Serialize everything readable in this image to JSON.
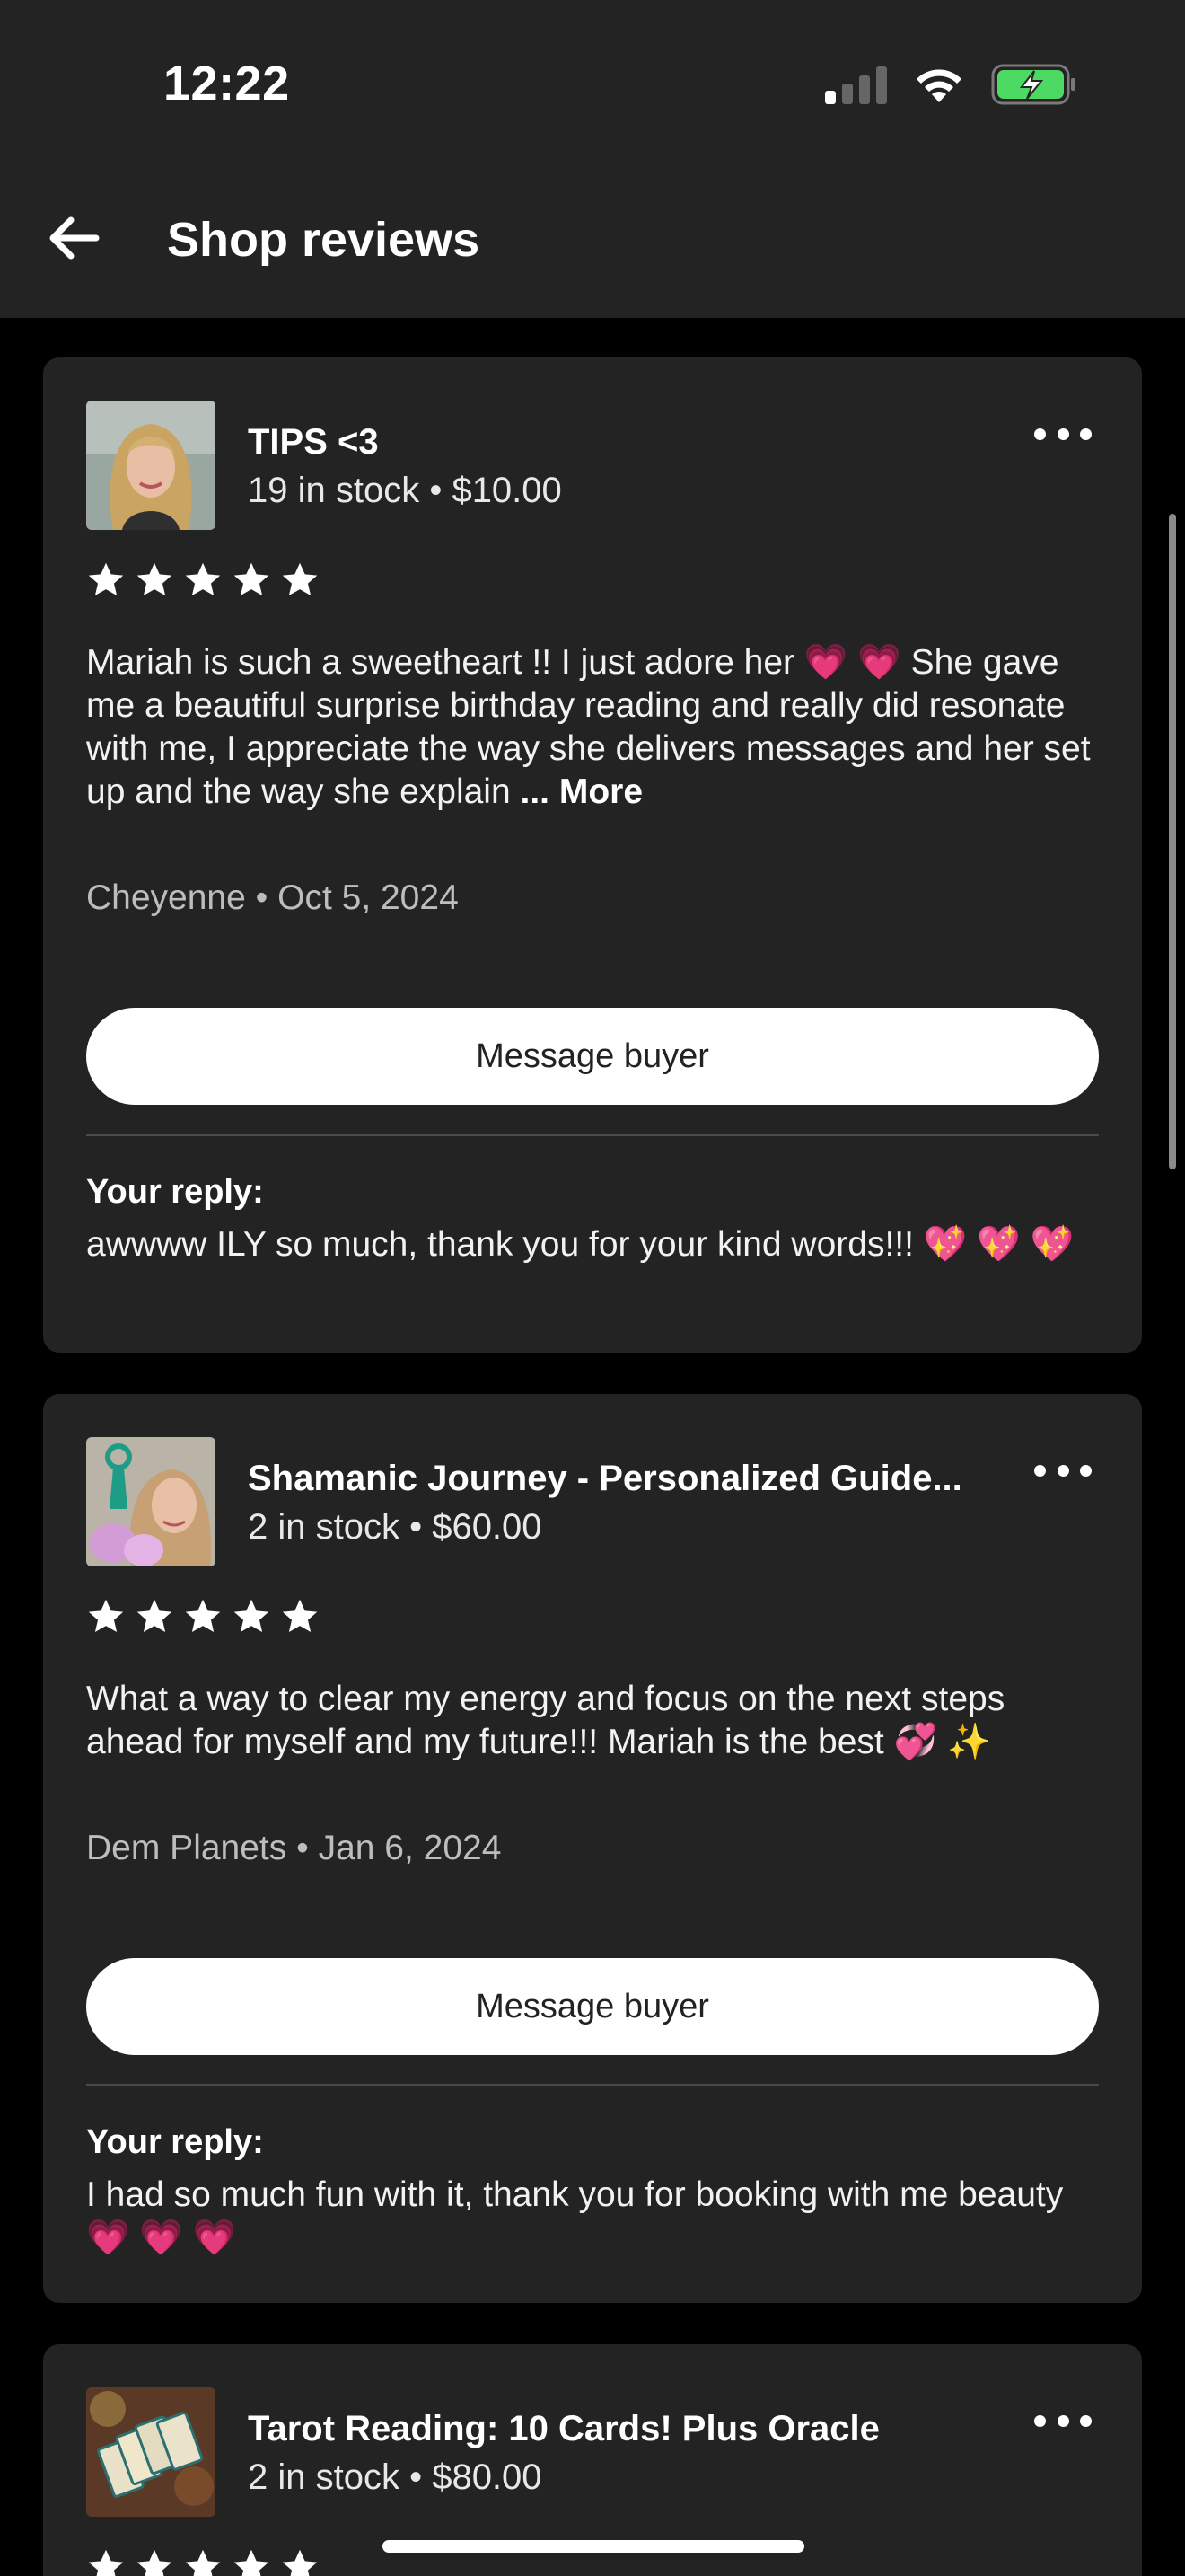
{
  "status_bar": {
    "time": "12:22"
  },
  "header": {
    "title": "Shop reviews"
  },
  "reviews": [
    {
      "listing_title": "TIPS <3",
      "listing_sub": "19 in stock • $10.00",
      "stars": 5,
      "text": "Mariah is such a sweetheart !! I just adore her  💗 💗  She gave me a beautiful surprise birthday reading and really did resonate with me, I appreciate the way she delivers messages and her set up and the way she explain ",
      "more_label": "... More",
      "meta": "Cheyenne • Oct 5, 2024",
      "button": "Message buyer",
      "reply_label": "Your reply:",
      "reply_text": "awwww ILY so much, thank you for your kind words!!! 💖 💖 💖"
    },
    {
      "listing_title": "Shamanic Journey - Personalized Guide...",
      "listing_sub": "2 in stock • $60.00",
      "stars": 5,
      "text": "What a way to clear my energy and focus on the next steps ahead for myself and my future!!! Mariah is the best 💞 ✨",
      "meta": "Dem Planets • Jan 6, 2024",
      "button": "Message buyer",
      "reply_label": "Your reply:",
      "reply_text": "I had so much fun with it, thank you for booking with me beauty 💗 💗 💗"
    },
    {
      "listing_title": "Tarot Reading: 10 Cards! Plus Oracle",
      "listing_sub": "2 in stock • $80.00",
      "stars": 5
    }
  ],
  "icons": {
    "back": "arrow-left-icon",
    "more": "more-horizontal-icon",
    "star": "star-icon",
    "wifi": "wifi-icon",
    "battery": "battery-charging-icon",
    "signal": "cellular-signal-icon"
  },
  "colors": {
    "background": "#000000",
    "surface": "#232323",
    "button_bg": "#ffffff",
    "battery_green": "#4cd964"
  }
}
